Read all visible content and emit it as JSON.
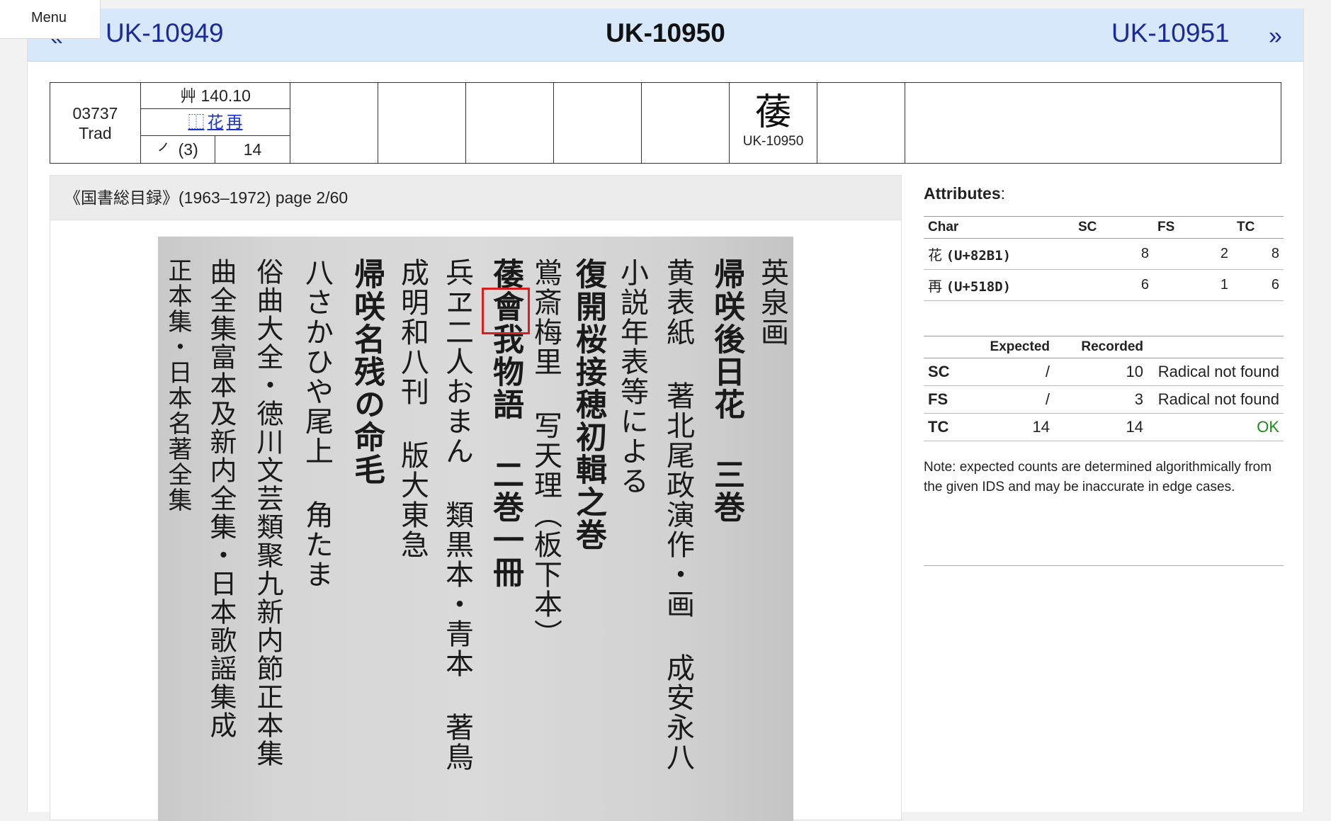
{
  "menu_label": "Menu",
  "nav": {
    "prev_arrow": "«",
    "prev": "UK-10949",
    "current": "UK-10950",
    "next": "UK-10951",
    "next_arrow": "»"
  },
  "entry": {
    "code": "03737",
    "type": "Trad",
    "radical": "艸 140.10",
    "ids_glyph": "⿰",
    "ids_comp1": "花",
    "ids_comp2": "再",
    "first_stroke": "㇒ (3)",
    "total_strokes": "14",
    "glyph": "䔀",
    "glyph_label": "UK-10950"
  },
  "source": {
    "title": "《国書総目録》(1963–1972) page 2/60",
    "scan_columns": [
      "英泉画",
      "帰咲後日花 三巻",
      "黄表紙 著北尾政演作・画 成安永八",
      "小説年表等による",
      "復開桜接穂初輯之巻",
      "鴬斎梅里 写天理（板下本）",
      "䔀會我物語 二巻一冊",
      "兵ヱ二人おまん 類黒本・青本 著鳥",
      "成明和八刊 版大東急",
      "帰咲名残の命毛",
      "八さかひや尾上 角たま",
      "俗曲大全・徳川文芸類聚九新内節正本集",
      "曲全集富本及新内全集・日本歌謡集成",
      "正本集・日本名著全集"
    ]
  },
  "attributes": {
    "title": "Attributes",
    "headers": [
      "Char",
      "SC",
      "FS",
      "TC"
    ],
    "rows": [
      {
        "char": "花",
        "code": "(U+82B1)",
        "sc": "8",
        "fs": "2",
        "tc": "8"
      },
      {
        "char": "再",
        "code": "(U+518D)",
        "sc": "6",
        "fs": "1",
        "tc": "6"
      }
    ]
  },
  "counts": {
    "headers": [
      "",
      "Expected",
      "Recorded",
      ""
    ],
    "rows": [
      {
        "label": "SC",
        "expected": "/",
        "recorded": "10",
        "status": "Radical not found"
      },
      {
        "label": "FS",
        "expected": "/",
        "recorded": "3",
        "status": "Radical not found"
      },
      {
        "label": "TC",
        "expected": "14",
        "recorded": "14",
        "status": "OK"
      }
    ]
  },
  "note": "Note: expected counts are determined algorithmically from the given IDS and may be inaccurate in edge cases."
}
